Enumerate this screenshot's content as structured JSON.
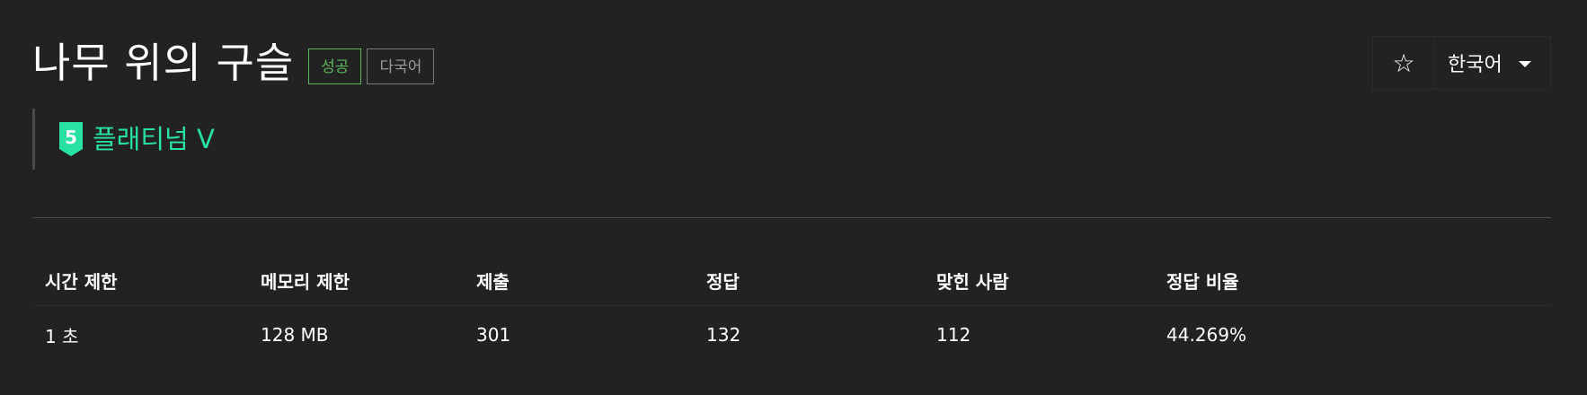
{
  "problem": {
    "title": "나무 위의 구슬",
    "labels": {
      "success": "성공",
      "multilang": "다국어"
    },
    "tier": {
      "number": "5",
      "name": "플래티넘 V",
      "color": "#27e2a4"
    }
  },
  "toolbar": {
    "star_icon": "star-outline-icon",
    "star_glyph": "☆",
    "language_label": "한국어"
  },
  "info_table": {
    "headers": [
      "시간 제한",
      "메모리 제한",
      "제출",
      "정답",
      "맞힌 사람",
      "정답 비율"
    ],
    "values": [
      "1 초",
      "128 MB",
      "301",
      "132",
      "112",
      "44.269%"
    ]
  },
  "colors": {
    "background": "#222222",
    "success": "#5cb85c",
    "tier": "#27e2a4"
  }
}
